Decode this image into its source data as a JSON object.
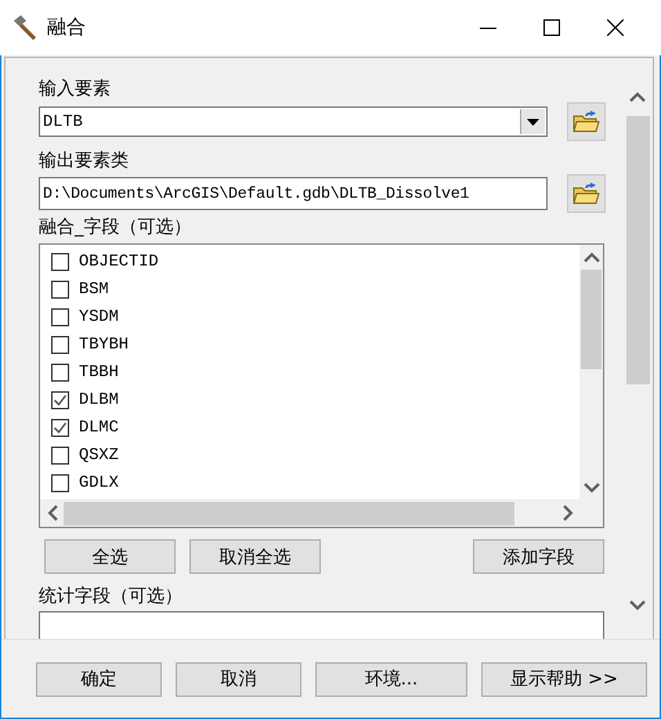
{
  "window": {
    "title": "融合"
  },
  "input_features": {
    "label": "输入要素",
    "value": "DLTB"
  },
  "output_feature_class": {
    "label": "输出要素类",
    "value": "D:\\Documents\\ArcGIS\\Default.gdb\\DLTB_Dissolve1"
  },
  "dissolve_fields": {
    "label": "融合_字段（可选）",
    "items": [
      {
        "label": "OBJECTID",
        "checked": false
      },
      {
        "label": "BSM",
        "checked": false
      },
      {
        "label": "YSDM",
        "checked": false
      },
      {
        "label": "TBYBH",
        "checked": false
      },
      {
        "label": "TBBH",
        "checked": false
      },
      {
        "label": "DLBM",
        "checked": true
      },
      {
        "label": "DLMC",
        "checked": true
      },
      {
        "label": "QSXZ",
        "checked": false
      },
      {
        "label": "GDLX",
        "checked": false
      }
    ],
    "buttons": [
      "全选",
      "取消全选",
      "添加字段"
    ]
  },
  "statistics_fields": {
    "label": "统计字段（可选）"
  },
  "buttons": [
    "确定",
    "取消",
    "环境...",
    "显示帮助 >>"
  ]
}
